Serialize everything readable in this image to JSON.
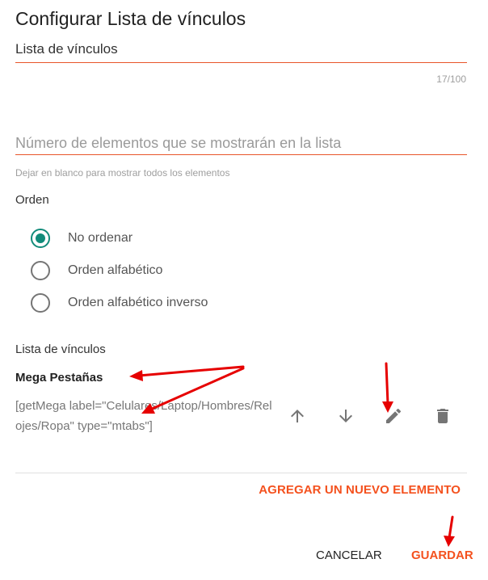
{
  "dialog": {
    "title": "Configurar Lista de vínculos"
  },
  "title_field": {
    "value": "Lista de vínculos",
    "counter": "17/100"
  },
  "count_field": {
    "placeholder": "Número de elementos que se mostrarán en la lista",
    "hint": "Dejar en blanco para mostrar todos los elementos"
  },
  "order": {
    "label": "Orden",
    "options": [
      {
        "label": "No ordenar",
        "checked": true
      },
      {
        "label": "Orden alfabético",
        "checked": false
      },
      {
        "label": "Orden alfabético inverso",
        "checked": false
      }
    ]
  },
  "links": {
    "label": "Lista de vínculos",
    "items": [
      {
        "name": "Mega Pestañas",
        "code": "[getMega label=\"Celulares/Laptop/Hombres/Relojes/Ropa\" type=\"mtabs\"]"
      }
    ],
    "add_label": "AGREGAR UN NUEVO ELEMENTO"
  },
  "actions": {
    "cancel_label": "CANCELAR",
    "save_label": "GUARDAR"
  },
  "icons": {
    "move_up": "arrow-up-icon",
    "move_down": "arrow-down-icon",
    "edit": "pencil-icon",
    "delete": "trash-icon"
  },
  "colors": {
    "accent": "#f4511e",
    "underline": "#e8552a",
    "radio_checked": "#128b7a",
    "annotation_arrow": "#e60000"
  }
}
